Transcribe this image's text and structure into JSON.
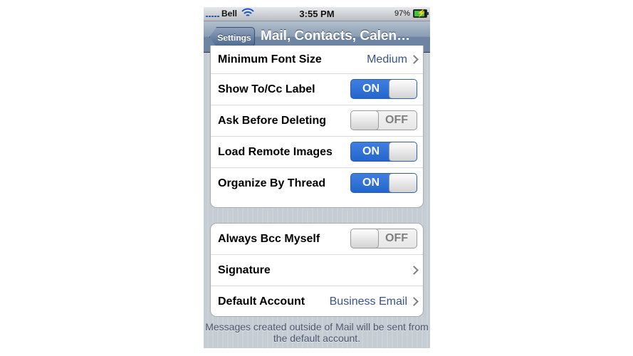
{
  "status_bar": {
    "carrier": "Bell",
    "time": "3:55 PM",
    "battery_percent": "97%",
    "battery_level": 0.97,
    "signal_icon": "signal-bars-icon",
    "wifi_icon": "wifi-icon",
    "battery_icon": "battery-charging-icon"
  },
  "nav": {
    "back_label": "Settings",
    "title": "Mail, Contacts, Calen…"
  },
  "group1": {
    "rows": [
      {
        "label": "Minimum Font Size",
        "value": "Medium"
      },
      {
        "label": "Show To/Cc Label",
        "toggle": "ON"
      },
      {
        "label": "Ask Before Deleting",
        "toggle": "OFF"
      },
      {
        "label": "Load Remote Images",
        "toggle": "ON"
      },
      {
        "label": "Organize By Thread",
        "toggle": "ON"
      }
    ]
  },
  "group2": {
    "rows": [
      {
        "label": "Always Bcc Myself",
        "toggle": "OFF"
      },
      {
        "label": "Signature"
      },
      {
        "label": "Default Account",
        "value": "Business Email"
      }
    ]
  },
  "footer_note": "Messages created outside of Mail will be sent from the default account.",
  "colors": {
    "toggle_on": "#2466cc",
    "value_text": "#385487",
    "nav_bar": "#6d84a2"
  }
}
